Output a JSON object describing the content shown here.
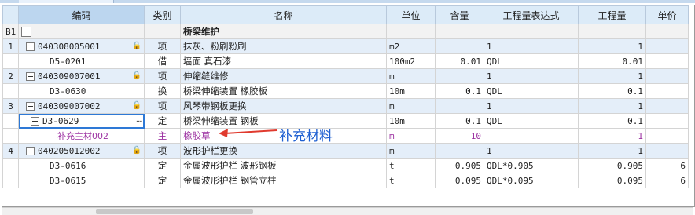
{
  "columns": [
    "编码",
    "类别",
    "名称",
    "单位",
    "含量",
    "工程量表达式",
    "工程量",
    "单价"
  ],
  "rows": [
    {
      "no": "B1",
      "code": "",
      "type": "",
      "name": "桥梁维护",
      "unit": "",
      "qty": "",
      "expr": "",
      "amount": "",
      "price": "",
      "cls": "b1"
    },
    {
      "no": "1",
      "code": "040308005001",
      "type": "项",
      "name": "抹灰、粉刷粉刷",
      "unit": "m2",
      "qty": "",
      "expr": "1",
      "amount": "1",
      "price": "",
      "cls": "grp",
      "lock": true
    },
    {
      "no": "",
      "code": "D5-0201",
      "type": "借",
      "name": "墙面 真石漆",
      "unit": "100m2",
      "qty": "0.01",
      "expr": "QDL",
      "amount": "0.01",
      "price": "",
      "cls": "sub"
    },
    {
      "no": "2",
      "code": "040309007001",
      "type": "项",
      "name": "伸缩缝维修",
      "unit": "m",
      "qty": "",
      "expr": "1",
      "amount": "1",
      "price": "",
      "cls": "grp",
      "lock": true
    },
    {
      "no": "",
      "code": "D3-0630",
      "type": "换",
      "name": "桥梁伸缩装置 橡胶板",
      "unit": "10m",
      "qty": "0.1",
      "expr": "QDL",
      "amount": "0.1",
      "price": "",
      "cls": "sub"
    },
    {
      "no": "3",
      "code": "040309007002",
      "type": "项",
      "name": "风琴带钢板更换",
      "unit": "m",
      "qty": "",
      "expr": "1",
      "amount": "1",
      "price": "",
      "cls": "grp",
      "lock": true
    },
    {
      "no": "",
      "code": "D3-0629",
      "type": "定",
      "name": "桥梁伸缩装置 钢板",
      "unit": "10m",
      "qty": "0.1",
      "expr": "QDL",
      "amount": "0.1",
      "price": "",
      "cls": "edit"
    },
    {
      "no": "",
      "code": "补充主材002",
      "type": "主",
      "name": "橡胶草",
      "unit": "m",
      "qty": "10",
      "expr": "",
      "amount": "1",
      "price": "",
      "cls": "sup"
    },
    {
      "no": "4",
      "code": "040205012002",
      "type": "项",
      "name": "波形护栏更换",
      "unit": "m",
      "qty": "",
      "expr": "1",
      "amount": "1",
      "price": "",
      "cls": "grp",
      "lock": true
    },
    {
      "no": "",
      "code": "D3-0616",
      "type": "定",
      "name": "金属波形护栏 波形钢板",
      "unit": "t",
      "qty": "0.905",
      "expr": "QDL*0.905",
      "amount": "0.905",
      "price": "6",
      "cls": "sub"
    },
    {
      "no": "",
      "code": "D3-0615",
      "type": "定",
      "name": "金属波形护栏 钢管立柱",
      "unit": "t",
      "qty": "0.095",
      "expr": "QDL*0.095",
      "amount": "0.095",
      "price": "6",
      "cls": "sub"
    }
  ],
  "annotation": "补充材料",
  "colors": {
    "header": "#dcebf8",
    "group": "#e4eef9",
    "supplement": "#9b2fa0",
    "annotation": "#1e5fd1"
  }
}
